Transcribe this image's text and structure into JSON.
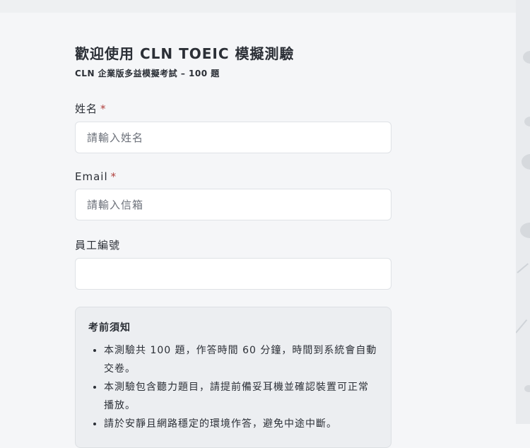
{
  "page": {
    "title": "歡迎使用 CLN TOEIC 模擬測驗",
    "subtitle": "CLN 企業版多益模擬考試 – 100 題"
  },
  "form": {
    "name": {
      "label": "姓名",
      "required_mark": "*",
      "placeholder": "請輸入姓名",
      "value": ""
    },
    "email": {
      "label": "Email",
      "required_mark": "*",
      "placeholder": "請輸入信箱",
      "value": ""
    },
    "employee_id": {
      "label": "員工編號",
      "placeholder": "",
      "value": ""
    }
  },
  "notice": {
    "title": "考前須知",
    "items": [
      "本測驗共 100 題，作答時間 60 分鐘，時間到系統會自動交卷。",
      "本測驗包含聽力題目，請提前備妥耳機並確認裝置可正常播放。",
      "請於安靜且網路穩定的環境作答，避免中途中斷。"
    ]
  },
  "colors": {
    "background": "#f5f6f8",
    "required": "#b0413e",
    "notice_bg": "#eceef1"
  }
}
